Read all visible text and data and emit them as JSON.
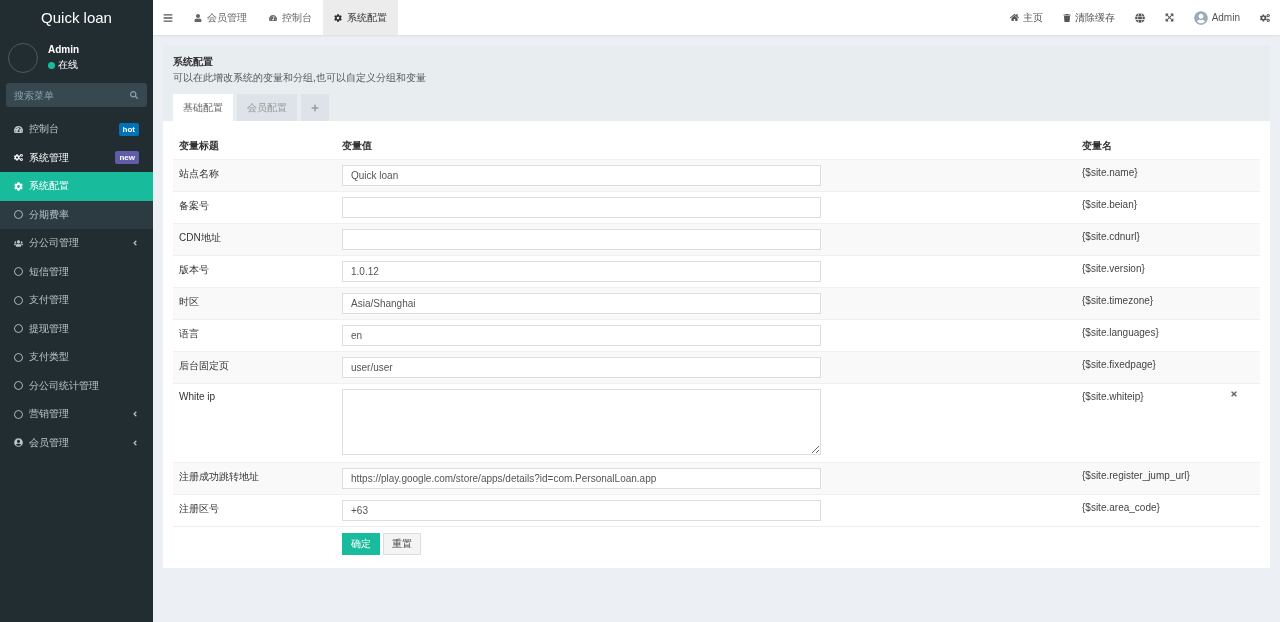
{
  "brand": "Quick loan",
  "user": {
    "name": "Admin",
    "status": "在线"
  },
  "search": {
    "placeholder": "搜索菜单"
  },
  "menu": [
    {
      "label": "控制台",
      "badge": "hot",
      "color": "#0073b7"
    },
    {
      "label": "系统管理",
      "badge": "new",
      "color": "#605ca8",
      "expanded": true,
      "children": [
        {
          "label": "系统配置",
          "selected": true
        },
        {
          "label": "分期费率",
          "selected": false
        }
      ]
    },
    {
      "label": "分公司管理",
      "expanded": false
    },
    {
      "label": "短信管理"
    },
    {
      "label": "支付管理"
    },
    {
      "label": "提现管理"
    },
    {
      "label": "支付类型"
    },
    {
      "label": "分公司统计管理"
    },
    {
      "label": "营销管理",
      "expanded": false
    },
    {
      "label": "会员管理",
      "expanded": false
    }
  ],
  "nav_tabs": [
    {
      "label": "会员管理",
      "selected": false
    },
    {
      "label": "控制台",
      "selected": false
    },
    {
      "label": "系统配置",
      "selected": true
    }
  ],
  "nav_right": {
    "home": "主页",
    "clear_cache": "清除缓存",
    "user": "Admin"
  },
  "panel": {
    "title": "系统配置",
    "description": "可以在此增改系统的变量和分组,也可以自定义分组和变量",
    "tabs": [
      {
        "label": "基础配置",
        "selected": true
      },
      {
        "label": "会员配置",
        "selected": false
      }
    ],
    "columns": [
      "变量标题",
      "变量值",
      "变量名"
    ],
    "rows": [
      {
        "title": "站点名称",
        "kind": "text",
        "value": "Quick loan",
        "name": "{$site.name}"
      },
      {
        "title": "备案号",
        "kind": "text",
        "value": "",
        "name": "{$site.beian}"
      },
      {
        "title": "CDN地址",
        "kind": "text",
        "value": "",
        "name": "{$site.cdnurl}"
      },
      {
        "title": "版本号",
        "kind": "text",
        "value": "1.0.12",
        "name": "{$site.version}"
      },
      {
        "title": "时区",
        "kind": "text",
        "value": "Asia/Shanghai",
        "name": "{$site.timezone}"
      },
      {
        "title": "语言",
        "kind": "text",
        "value": "en",
        "name": "{$site.languages}"
      },
      {
        "title": "后台固定页",
        "kind": "text",
        "value": "user/user",
        "name": "{$site.fixedpage}"
      },
      {
        "title": "White ip",
        "kind": "textarea",
        "value": "",
        "name": "{$site.whiteip}",
        "deletable": true
      },
      {
        "title": "注册成功跳转地址",
        "kind": "text",
        "value": "https://play.google.com/store/apps/details?id=com.PersonalLoan.app",
        "name": "{$site.register_jump_url}"
      },
      {
        "title": "注册区号",
        "kind": "text",
        "value": "+63",
        "name": "{$site.area_code}"
      }
    ],
    "buttons": {
      "submit": "确定",
      "reset": "重置"
    }
  }
}
